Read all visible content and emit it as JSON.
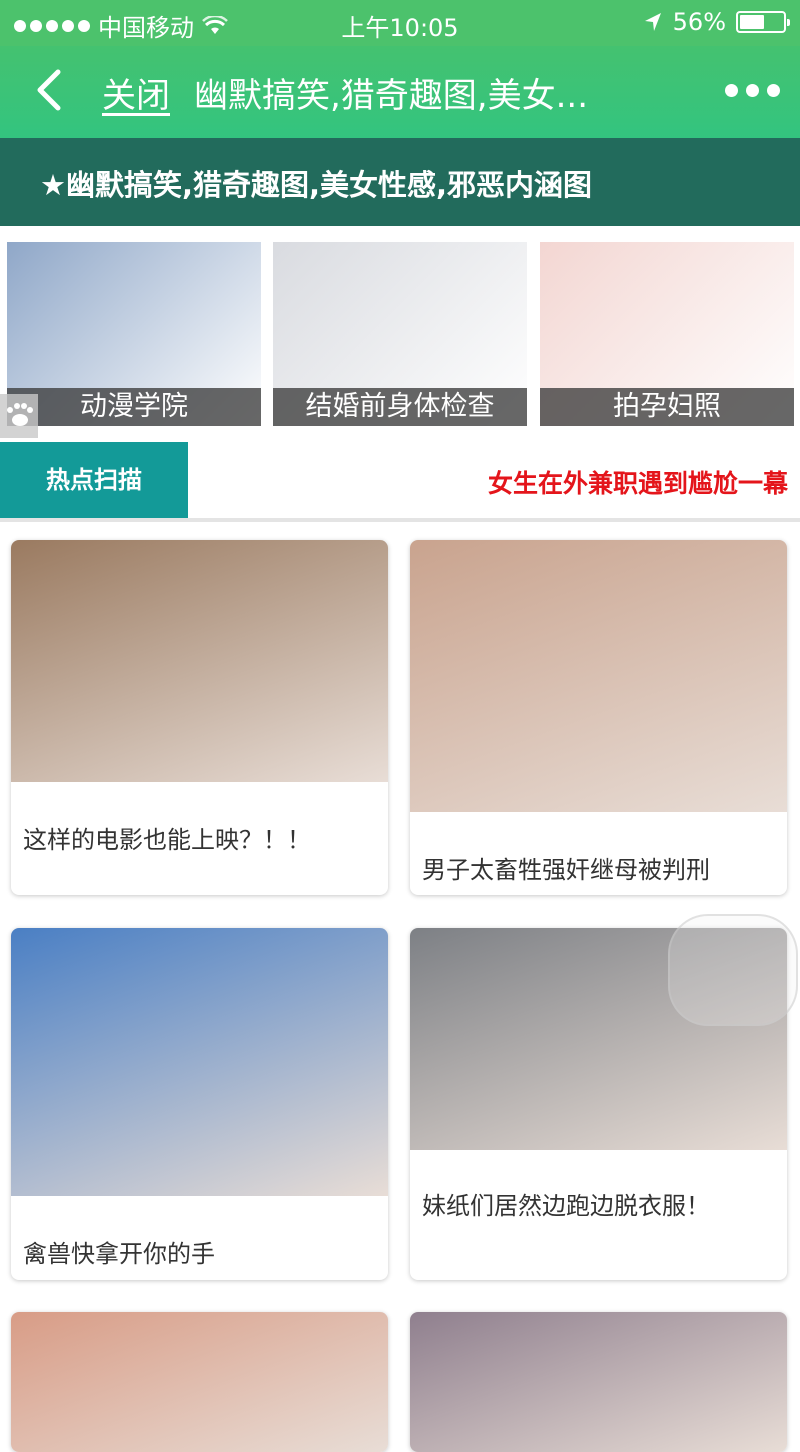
{
  "status_bar": {
    "carrier": "中国移动",
    "time": "上午10:05",
    "battery": "56%",
    "battery_level": 0.56
  },
  "nav": {
    "close_label": "关闭",
    "title": "幽默搞笑,猎奇趣图,美女..."
  },
  "banner": {
    "text": "★幽默搞笑,猎奇趣图,美女性感,邪恶内涵图"
  },
  "categories": [
    {
      "label": "动漫学院",
      "color": "#8fa7c8"
    },
    {
      "label": "结婚前身体检查",
      "color": "#d9dbe0"
    },
    {
      "label": "拍孕妇照",
      "color": "#f3d6d2"
    }
  ],
  "hot": {
    "tab_label": "热点扫描",
    "marquee": "女生在外兼职遇到尴尬一幕"
  },
  "cards": [
    {
      "title": "这样的电影也能上映？！！",
      "color": "#9a7a60"
    },
    {
      "title": "男子太畜牲强奸继母被判刑",
      "color": "#c9a38e"
    },
    {
      "title": "禽兽快拿开你的手",
      "color": "#4a7fc4"
    },
    {
      "title": "妹纸们居然边跑边脱衣服！",
      "color": "#7d8085"
    },
    {
      "title": "",
      "color": "#d89c86"
    },
    {
      "title": "",
      "color": "#8f7f8e"
    }
  ]
}
